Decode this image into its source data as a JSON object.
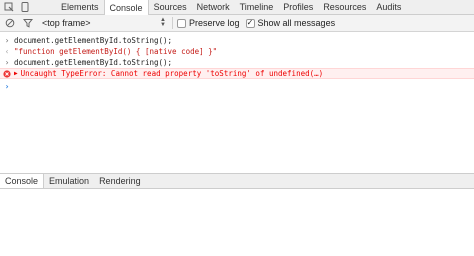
{
  "tabbar": {
    "tabs": [
      {
        "label": "Elements"
      },
      {
        "label": "Console"
      },
      {
        "label": "Sources"
      },
      {
        "label": "Network"
      },
      {
        "label": "Timeline"
      },
      {
        "label": "Profiles"
      },
      {
        "label": "Resources"
      },
      {
        "label": "Audits"
      }
    ],
    "active_tab": "Console",
    "icons": [
      "inspect-icon",
      "device-mode-icon"
    ]
  },
  "toolbar": {
    "clear_icon": "clear-icon",
    "filter_icon": "filter-icon",
    "frame_select": "<top frame>",
    "preserve_log_label": "Preserve log",
    "preserve_log_checked": false,
    "show_all_label": "Show all messages",
    "show_all_checked": true
  },
  "console": {
    "lines": [
      {
        "kind": "input",
        "text": "document.getElementById.toString();"
      },
      {
        "kind": "result",
        "text": "\"function getElementById() { [native code] }\""
      },
      {
        "kind": "input",
        "text": "document.getElementById.toString();"
      },
      {
        "kind": "error",
        "text": "Uncaught TypeError: Cannot read property 'toString' of undefined(…)"
      }
    ]
  },
  "drawer": {
    "tabs": [
      {
        "label": "Console"
      },
      {
        "label": "Emulation"
      },
      {
        "label": "Rendering"
      }
    ],
    "active_tab": "Console"
  },
  "colors": {
    "error_text": "#e00000",
    "error_bg": "#fff0f0",
    "string_text": "#c41a16",
    "prompt": "#2a7fe0"
  }
}
